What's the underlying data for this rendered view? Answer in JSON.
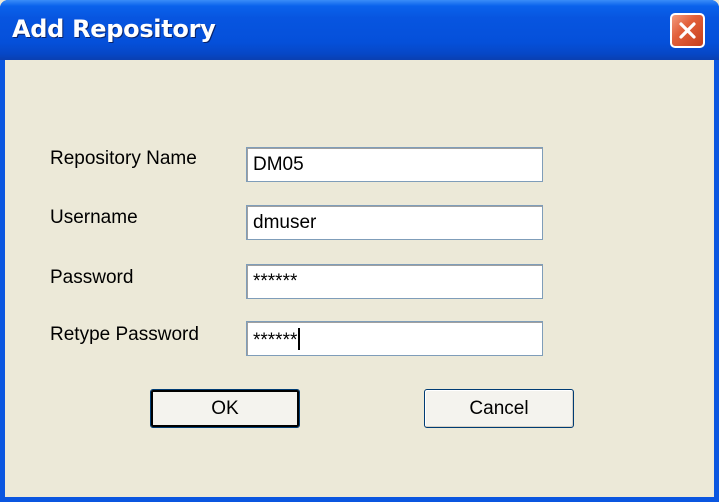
{
  "window": {
    "title": "Add Repository",
    "close_icon": "close-icon"
  },
  "form": {
    "fields": [
      {
        "label": "Repository Name",
        "value": "DM05"
      },
      {
        "label": "Username",
        "value": "dmuser"
      },
      {
        "label": "Password",
        "value": "******"
      },
      {
        "label": "Retype Password",
        "value": "******"
      }
    ]
  },
  "buttons": {
    "ok_label": "OK",
    "cancel_label": "Cancel"
  },
  "colors": {
    "titlebar": "#0550DA",
    "dialog_bg": "#ECE9D8",
    "close_button": "#E2603A"
  }
}
